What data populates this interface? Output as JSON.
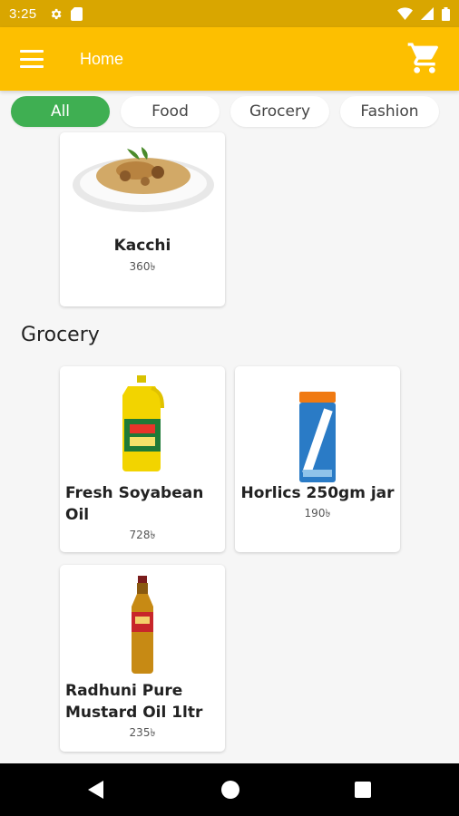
{
  "status_bar": {
    "time": "3:25",
    "icons": [
      "gear-icon",
      "sim-card-icon",
      "wifi-icon",
      "signal-icon",
      "battery-icon"
    ]
  },
  "app_bar": {
    "title": "Home",
    "icons": [
      "menu-icon",
      "cart-icon"
    ]
  },
  "filters": {
    "items": [
      {
        "label": "All",
        "active": true
      },
      {
        "label": "Food",
        "active": false
      },
      {
        "label": "Grocery",
        "active": false
      },
      {
        "label": "Fashion",
        "active": false
      }
    ]
  },
  "products_top": [
    {
      "name": "Kacchi",
      "price": "360৳",
      "image": "kacchi-biryani"
    }
  ],
  "grocery": {
    "title": "Grocery",
    "items": [
      {
        "name": "Fresh Soyabean Oil",
        "price": "728৳",
        "image": "soyabean-oil-bottle"
      },
      {
        "name": "Horlics 250gm jar",
        "price": "190৳",
        "image": "horlicks-jar"
      },
      {
        "name": "Radhuni Pure Mustard Oil 1ltr",
        "price": "235৳",
        "image": "mustard-oil-bottle"
      }
    ]
  },
  "nav": {
    "icons": [
      "back-icon",
      "home-icon",
      "recents-icon"
    ]
  },
  "colors": {
    "status_bar": "#d9a600",
    "app_bar": "#fdbf00",
    "chip_active": "#3faf52",
    "background": "#f6f6f6"
  }
}
